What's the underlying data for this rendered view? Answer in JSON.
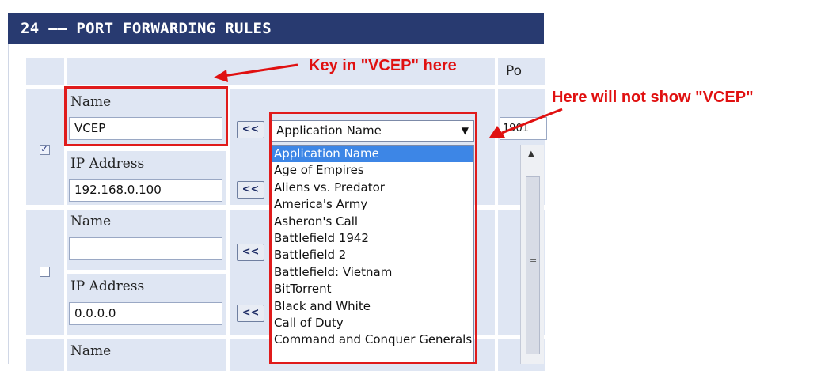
{
  "section": {
    "title": "24 —— PORT FORWARDING RULES",
    "port_header": "Po"
  },
  "rules": [
    {
      "checked": true,
      "name_label": "Name",
      "name_value": "VCEP",
      "ip_label": "IP Address",
      "ip_value": "192.168.0.100",
      "port_value": "1901"
    },
    {
      "checked": false,
      "name_label": "Name",
      "name_value": "",
      "ip_label": "IP Address",
      "ip_value": "0.0.0.0"
    },
    {
      "name_label": "Name"
    }
  ],
  "copy_button_label": "<<",
  "app_dropdown": {
    "selected": "Application Name",
    "options": [
      "Application Name",
      "Age of Empires",
      "Aliens vs. Predator",
      "America's Army",
      "Asheron's Call",
      "Battlefield 1942",
      "Battlefield 2",
      "Battlefield: Vietnam",
      "BitTorrent",
      "Black and White",
      "Call of Duty",
      "Command and Conquer Generals"
    ]
  },
  "annotations": {
    "key_in": "Key in \"VCEP\" here",
    "not_show": "Here will not show \"VCEP\""
  },
  "colors": {
    "title_bg": "#283a70",
    "cell_bg": "#dfe6f3",
    "annotation_red": "#e01010",
    "selected_option": "#3d86e6"
  },
  "icons": {
    "dropdown": "triangle-down-icon",
    "arrow": "red-arrow-icon",
    "checkbox": "checkbox-icon"
  }
}
